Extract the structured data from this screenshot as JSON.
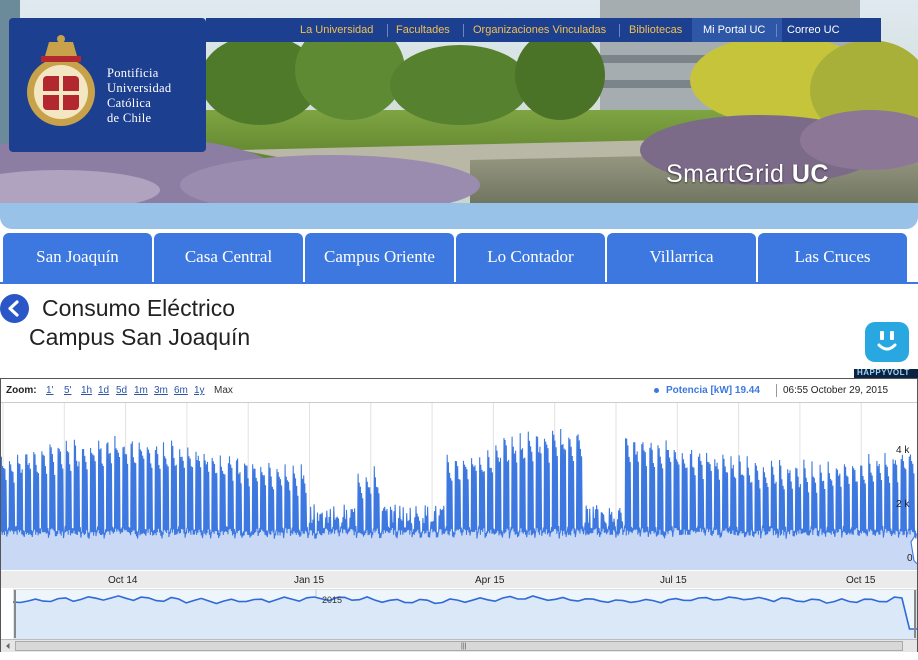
{
  "site": {
    "name_lines": [
      "Pontificia",
      "Universidad",
      "Católica",
      "de Chile"
    ],
    "brand_prefix": "SmartGrid",
    "brand_suffix": "UC"
  },
  "top_nav": [
    {
      "label": "La Universidad"
    },
    {
      "label": "Facultades"
    },
    {
      "label": "Organizaciones Vinculadas"
    },
    {
      "label": "Bibliotecas"
    },
    {
      "label": "Mi Portal UC"
    },
    {
      "label": "Correo UC"
    }
  ],
  "campus_tabs": [
    {
      "label": "San Joaquín"
    },
    {
      "label": "Casa Central"
    },
    {
      "label": "Campus Oriente"
    },
    {
      "label": "Lo Contador"
    },
    {
      "label": "Villarrica"
    },
    {
      "label": "Las Cruces"
    }
  ],
  "page": {
    "title": "Consumo Eléctrico",
    "subtitle": "Campus San Joaquín",
    "partner_badge": "HAPPYVOLT"
  },
  "chart_toolbar": {
    "zoom_label": "Zoom:",
    "zoom_options": [
      "1'",
      "5'",
      "1h",
      "1d",
      "5d",
      "1m",
      "3m",
      "6m",
      "1y",
      "Max"
    ],
    "active_zoom": "Max",
    "legend": "Potencia [kW] 19.44",
    "timestamp": "06:55 October 29, 2015"
  },
  "colors": {
    "nav_blue": "#1d3f8f",
    "tab_blue": "#3c78e0",
    "link_orange": "#f2c14e",
    "series_line": "#3c78e0",
    "series_fill": "#c9d9f5"
  },
  "chart_data": {
    "type": "area",
    "title": "",
    "series": [
      {
        "name": "Potencia [kW]"
      }
    ],
    "x_ticks": [
      "Oct 14",
      "Jan 15",
      "Apr 15",
      "Jul 15",
      "Oct 15"
    ],
    "y_ticks": [
      "0",
      "2 k",
      "4 k"
    ],
    "ylim": [
      0,
      4800
    ],
    "xlim": [
      "2013-08-28",
      "2015-10-29"
    ],
    "last_value": 19.44,
    "pattern": "weekly cycle: weekday daytime peaks around 2.8k–4.5k kW, nighttime and weekend baseline around 1.2k kW; low plateaus during holiday weeks",
    "navigator_label": "2015",
    "grid": true,
    "legend": "top-right"
  }
}
